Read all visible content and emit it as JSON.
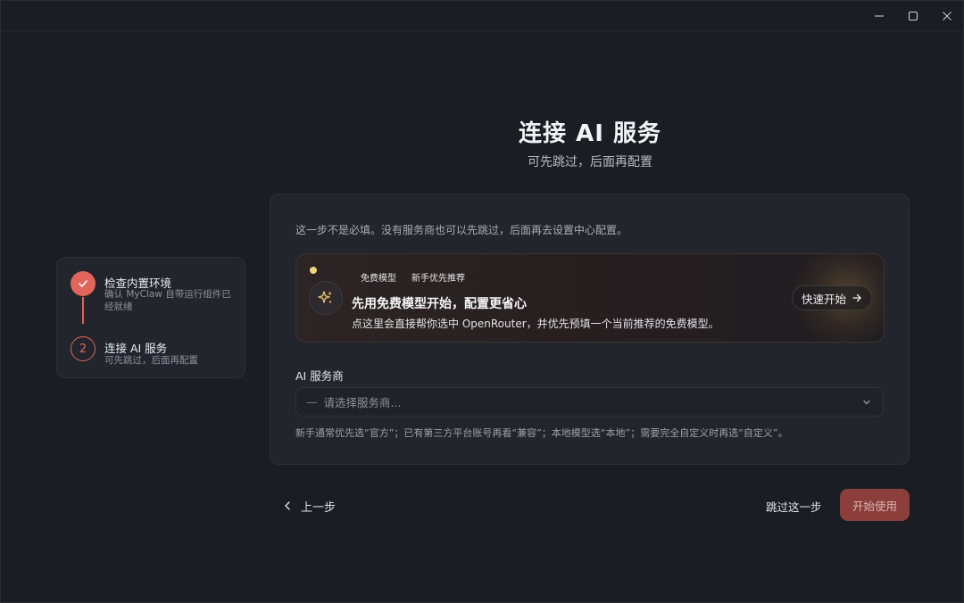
{
  "window": {
    "controls": {
      "minimize": "minimize-icon",
      "maximize": "maximize-icon",
      "close": "close-icon"
    }
  },
  "header": {
    "title": "连接 AI 服务",
    "subtitle": "可先跳过，后面再配置"
  },
  "steps": [
    {
      "index": "1",
      "status": "done",
      "title": "检查内置环境",
      "description": "确认 MyClaw 自带运行组件已经就绪"
    },
    {
      "index": "2",
      "status": "current",
      "title": "连接 AI 服务",
      "description": "可先跳过，后面再配置"
    }
  ],
  "card": {
    "intro": "这一步不是必填。没有服务商也可以先跳过，后面再去设置中心配置。",
    "promo": {
      "badge_free": "免费模型",
      "badge_recommend": "新手优先推荐",
      "heading": "先用免费模型开始，配置更省心",
      "description": "点这里会直接帮你选中 OpenRouter，并优先预填一个当前推荐的免费模型。",
      "quick_start_label": "快速开始",
      "icon": "sparkle-icon"
    },
    "provider": {
      "label": "AI 服务商",
      "placeholder": "请选择服务商...",
      "prefix": "—",
      "hint": "新手通常优先选“官方”；已有第三方平台账号再看“兼容”；本地模型选“本地”；需要完全自定义时再选“自定义”。"
    }
  },
  "footer": {
    "back_label": "上一步",
    "skip_label": "跳过这一步",
    "start_label": "开始使用"
  },
  "colors": {
    "accent": "#e0655a",
    "start_button_bg": "#8c3e3b",
    "background": "#1b1d24",
    "panel": "#22252c",
    "promo_dot": "#f2d57a"
  }
}
